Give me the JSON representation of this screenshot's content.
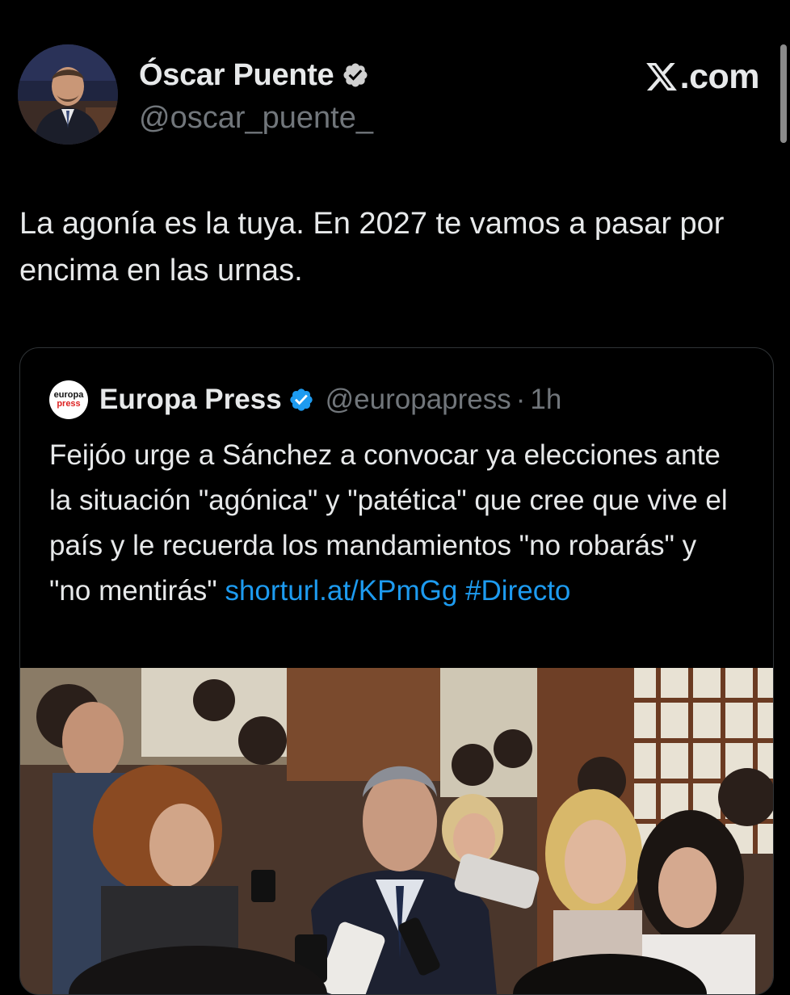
{
  "author": {
    "name": "Óscar Puente",
    "handle": "@oscar_puente_"
  },
  "brand": {
    "label": ".com",
    "icon": "x-logo-icon"
  },
  "tweet": {
    "text": "La agonía es la tuya. En 2027 te vamos a pasar por encima en las urnas."
  },
  "quoted": {
    "logo_line1": "europa",
    "logo_line2": "press",
    "name": "Europa Press",
    "handle": "@europapress",
    "separator": "·",
    "time": "1h",
    "text": "Feijóo urge a Sánchez a convocar ya elecciones ante la situación \"agónica\" y \"patética\" que cree que vive el país y le recuerda los mandamientos \"no robarás\" y \"no mentirás\" ",
    "link": "shorturl.at/KPmGg",
    "hashtag": "#Directo"
  },
  "colors": {
    "background": "#000000",
    "text": "#e7e9ea",
    "secondary": "#71767b",
    "link": "#1d9bf0",
    "verified": "#1d9bf0"
  }
}
